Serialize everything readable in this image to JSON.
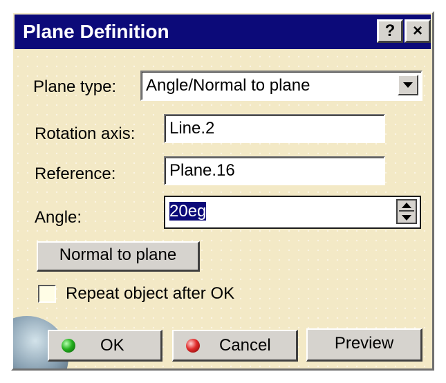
{
  "window": {
    "title": "Plane Definition",
    "help_label": "?",
    "close_label": "×"
  },
  "form": {
    "plane_type_label": "Plane type:",
    "plane_type_value": "Angle/Normal to plane",
    "rotation_axis_label": "Rotation axis:",
    "rotation_axis_value": "Line.2",
    "reference_label": "Reference:",
    "reference_value": "Plane.16",
    "angle_label": "Angle:",
    "angle_value": "20eg",
    "normal_button_label": "Normal to plane",
    "repeat_label": "Repeat object after OK",
    "repeat_checked": false
  },
  "footer": {
    "ok_label": "OK",
    "cancel_label": "Cancel",
    "preview_label": "Preview"
  },
  "colors": {
    "titlebar": "#0c0a79",
    "dialog_bg": "#f3e9c6",
    "button_face": "#d6d3ce",
    "ok_led": "#24b01e",
    "cancel_led": "#e02a2a"
  },
  "icons": [
    "help-icon",
    "close-icon",
    "dropdown-arrow-icon",
    "spinner-icon",
    "green-led-icon",
    "red-led-icon"
  ]
}
